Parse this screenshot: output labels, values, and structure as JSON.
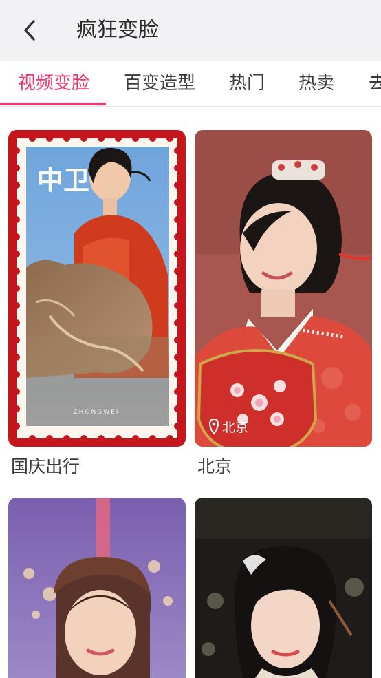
{
  "header": {
    "title": "疯狂变脸",
    "back_icon": "chevron-left-icon"
  },
  "tabs": [
    {
      "label": "视频变脸",
      "active": true
    },
    {
      "label": "百变造型",
      "active": false
    },
    {
      "label": "热门",
      "active": false
    },
    {
      "label": "热卖",
      "active": false
    },
    {
      "label": "去",
      "active": false
    }
  ],
  "colors": {
    "accent": "#f0386d",
    "header_bg": "#f2f2f4",
    "text": "#3a3a3a"
  },
  "templates": [
    {
      "label": "国庆出行",
      "stamp_text": "中卫",
      "watermark": "ZHONGWEI"
    },
    {
      "label": "北京",
      "location_tag": "北京",
      "location_icon": "location-pin-icon"
    },
    {
      "label": ""
    },
    {
      "label": ""
    }
  ]
}
